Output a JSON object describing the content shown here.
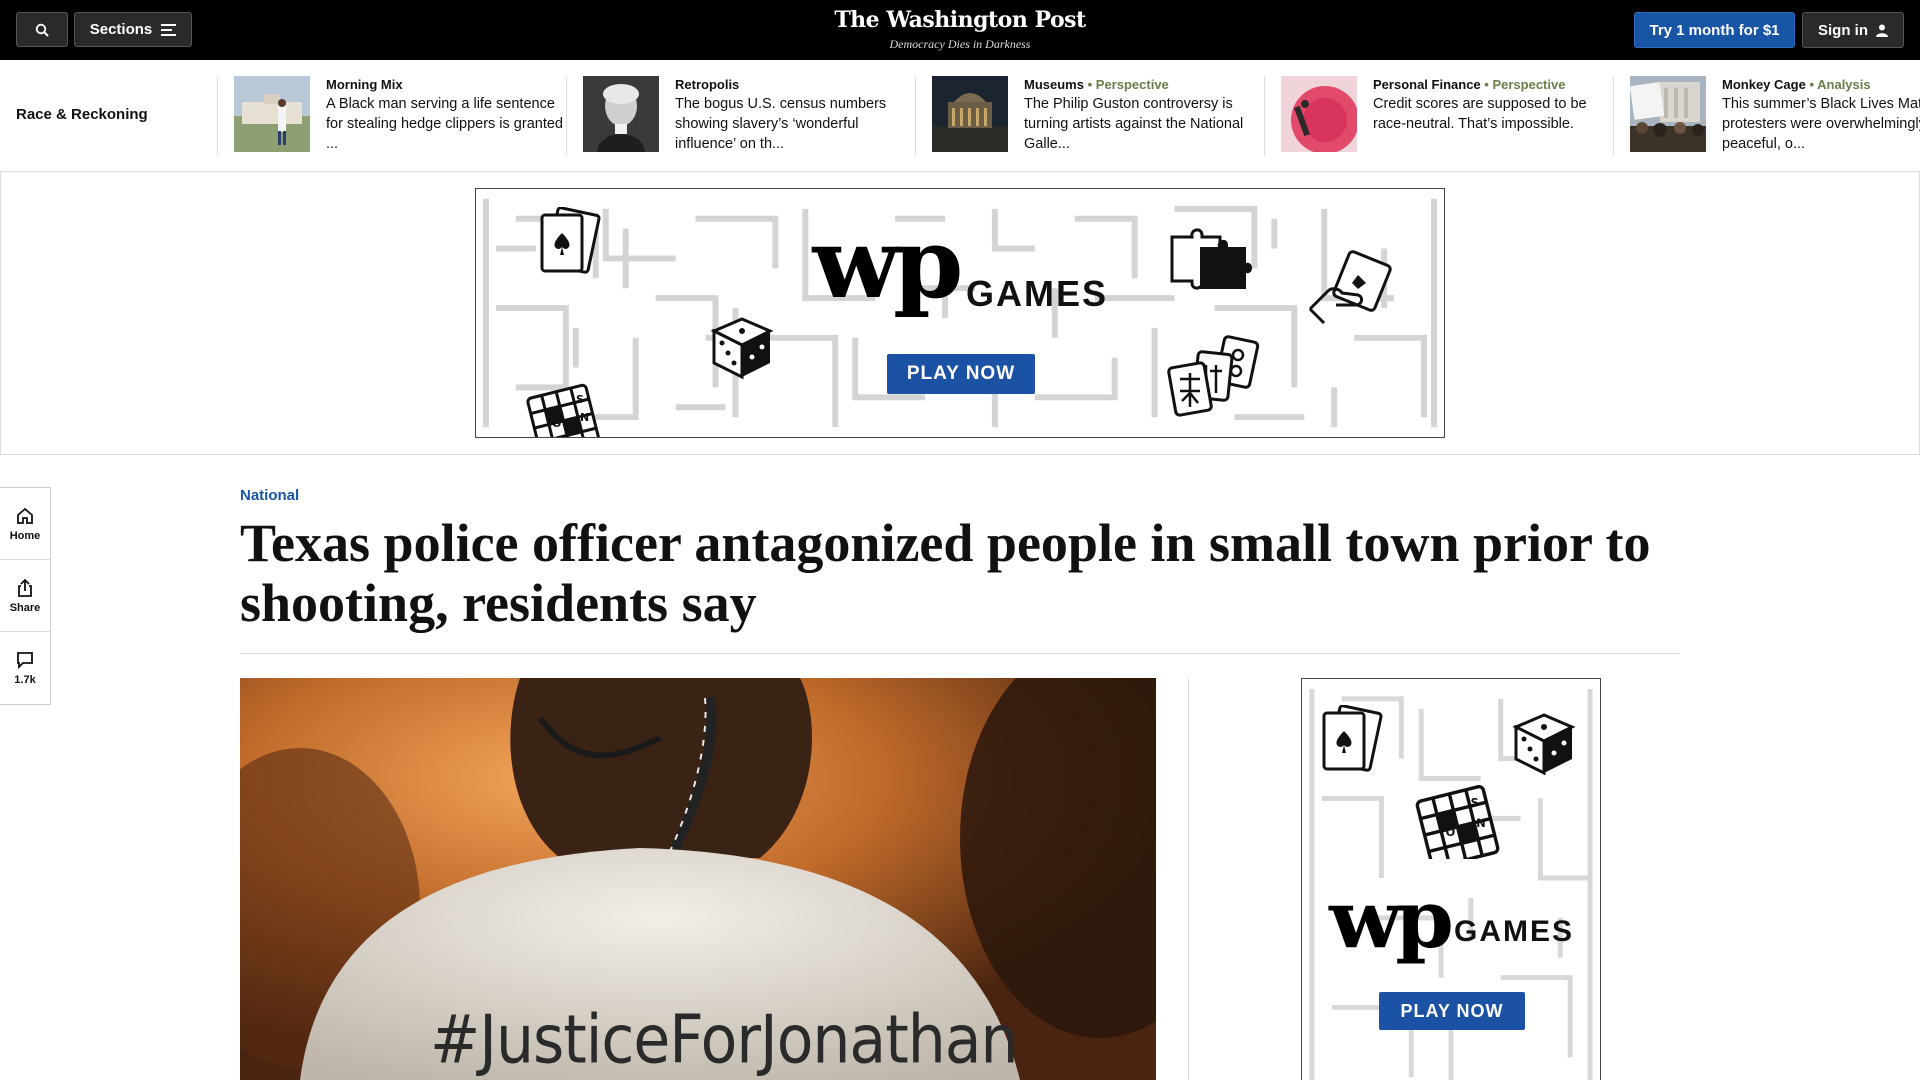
{
  "header": {
    "search_icon": "search-icon",
    "sections_label": "Sections",
    "brand": "The Washington Post",
    "tagline": "Democracy Dies in Darkness",
    "try_label": "Try 1 month for $1",
    "signin_label": "Sign in",
    "colors": {
      "bar": "#000000",
      "accent": "#1955a5"
    }
  },
  "strip": {
    "label": "Race & Reckoning",
    "items": [
      {
        "kicker": "Morning Mix",
        "sub": "",
        "headline": "A Black man serving a life sentence for stealing hedge clippers is granted ..."
      },
      {
        "kicker": "Retropolis",
        "sub": "",
        "headline": "The bogus U.S. census numbers showing slavery’s ‘wonderful influence’ on th..."
      },
      {
        "kicker": "Museums",
        "sub": "Perspective",
        "headline": "The Philip Guston controversy is turning artists against the National Galle..."
      },
      {
        "kicker": "Personal Finance",
        "sub": "Perspective",
        "headline": "Credit scores are supposed to be race-neutral. That’s impossible."
      },
      {
        "kicker": "Monkey Cage",
        "sub": "Analysis",
        "headline": "This summer’s Black Lives Matter protesters were overwhelmingly peaceful, o..."
      }
    ]
  },
  "ads": {
    "logo": "wp",
    "games": "GAMES",
    "play": "PLAY NOW"
  },
  "rail": {
    "home": "Home",
    "share": "Share",
    "comments": "1.7k"
  },
  "article": {
    "kicker": "National",
    "headline": "Texas police officer antagonized people in small town prior to shooting, residents say",
    "photo_text": "#JusticeForJonathan"
  }
}
